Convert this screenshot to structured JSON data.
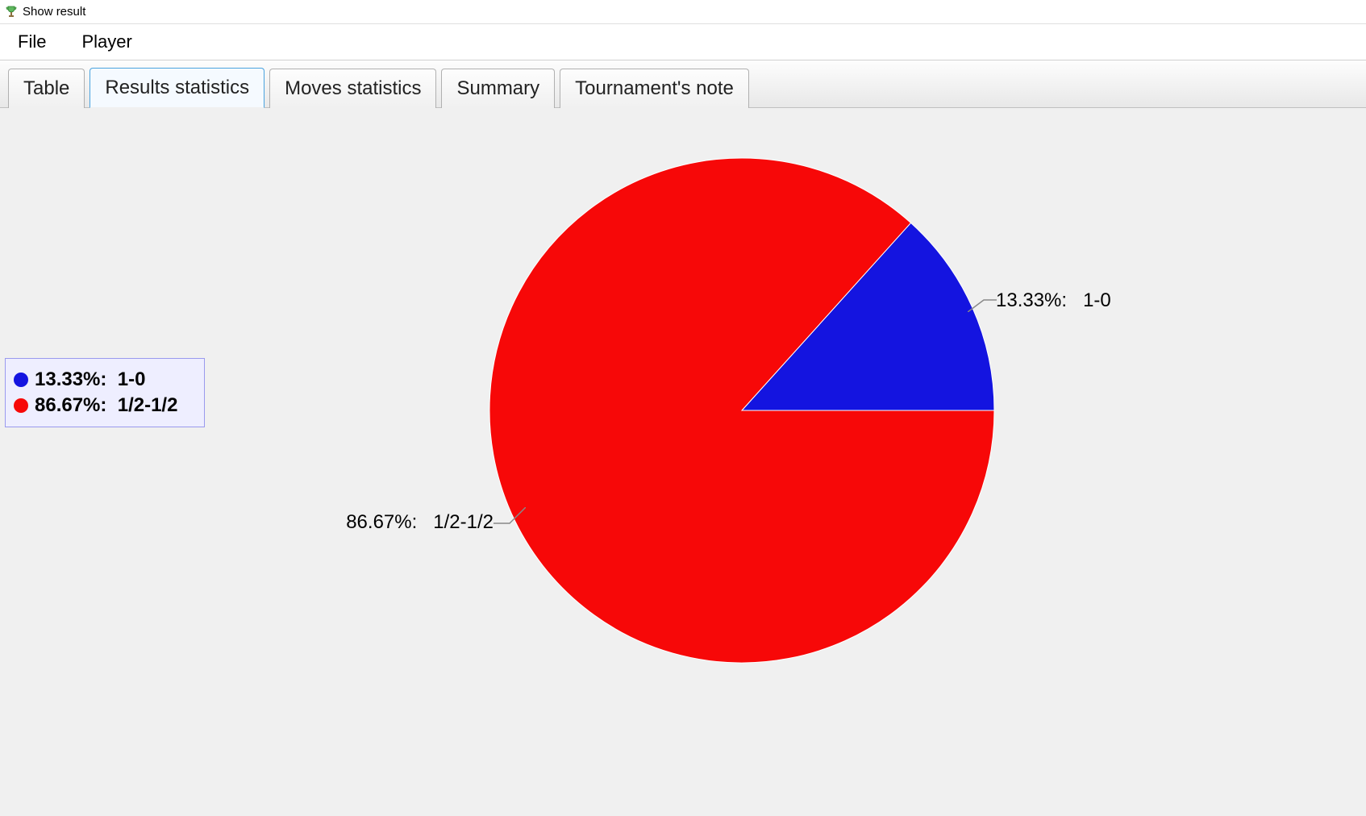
{
  "window": {
    "title": "Show result"
  },
  "menu": {
    "file": "File",
    "player": "Player"
  },
  "tabs": {
    "table": "Table",
    "results_stats": "Results statistics",
    "moves_stats": "Moves statistics",
    "summary": "Summary",
    "tournament_note": "Tournament's note"
  },
  "legend": {
    "row0": "13.33%:  1-0",
    "row1": "86.67%:  1/2-1/2"
  },
  "callouts": {
    "right": "13.33%:   1-0",
    "left": "86.67%:   1/2-1/2"
  },
  "colors": {
    "blue": "#1414e0",
    "red": "#f70808"
  },
  "chart_data": {
    "type": "pie",
    "series": [
      {
        "name": "1-0",
        "value": 13.33,
        "color": "#1414e0"
      },
      {
        "name": "1/2-1/2",
        "value": 86.67,
        "color": "#f70808"
      }
    ],
    "title": "",
    "xlabel": "",
    "ylabel": ""
  }
}
